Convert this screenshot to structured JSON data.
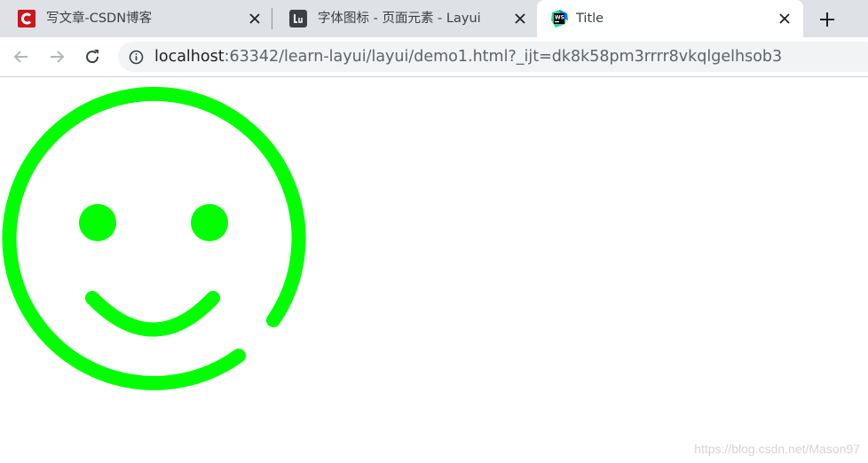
{
  "tabs": [
    {
      "title": "写文章-CSDN博客",
      "favicon": "csdn-icon",
      "active": false
    },
    {
      "title": "字体图标 - 页面元素 - Layui",
      "favicon": "layui-icon",
      "active": false
    },
    {
      "title": "Title",
      "favicon": "webstorm-icon",
      "active": true
    }
  ],
  "toolbar": {
    "url_host": "localhost",
    "url_rest": ":63342/learn-layui/layui/demo1.html?_ijt=dk8k58pm3rrrr8vkqlgelhsob3"
  },
  "page": {
    "icon": "smile-icon",
    "icon_color": "#00ff00"
  },
  "watermark": "https://blog.csdn.net/Mason97",
  "colors": {
    "tabstrip": "#dee1e6",
    "csdn_red": "#c9171e",
    "layui_dark": "#3c4043"
  }
}
